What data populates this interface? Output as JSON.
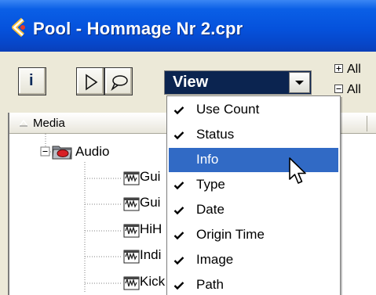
{
  "window": {
    "title": "Pool - Hommage Nr 2.cpr",
    "app_icon": "cubase-logo-icon"
  },
  "toolbar": {
    "info_button_label": "i",
    "play_icon": "play-icon",
    "loop_icon": "loop-icon",
    "view_select": {
      "value": "View"
    },
    "expand_all": "All",
    "collapse_all": "All"
  },
  "column_header": {
    "media_label": "Media"
  },
  "tree": {
    "folder": "Audio",
    "clips": [
      "Gui",
      "Gui",
      "HiH",
      "Indi",
      "Kick"
    ]
  },
  "view_menu": {
    "items": [
      {
        "label": "Use Count",
        "checked": true
      },
      {
        "label": "Status",
        "checked": true
      },
      {
        "label": "Info",
        "checked": false,
        "highlighted": true
      },
      {
        "label": "Type",
        "checked": true
      },
      {
        "label": "Date",
        "checked": true
      },
      {
        "label": "Origin Time",
        "checked": true
      },
      {
        "label": "Image",
        "checked": true
      },
      {
        "label": "Path",
        "checked": true
      }
    ]
  },
  "colors": {
    "title_bar": "#0552dc",
    "menu_highlight": "#316ac5",
    "view_select_bg": "#0b2450",
    "window_bg": "#ece9d8"
  }
}
